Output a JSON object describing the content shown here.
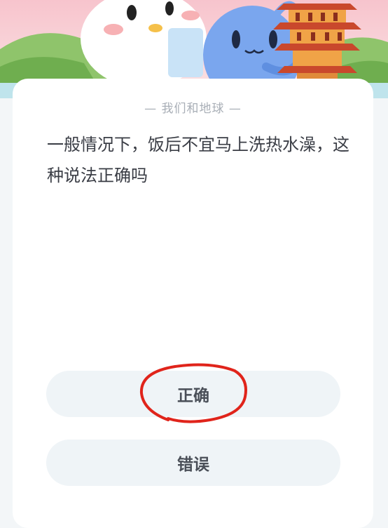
{
  "quiz": {
    "category": "我们和地球",
    "question": "一般情况下，饭后不宜马上洗热水澡，这种说法正确吗",
    "answers": [
      {
        "label": "正确",
        "marked": true
      },
      {
        "label": "错误",
        "marked": false
      }
    ]
  },
  "colors": {
    "annotation": "#e0241b",
    "page_background": "#f3f6f8",
    "button_background": "#eff4f7"
  },
  "icons": {
    "banner_left": "white-penguin-mascot",
    "banner_middle": "blue-creature-mascot",
    "banner_right": "pagoda-tower"
  }
}
